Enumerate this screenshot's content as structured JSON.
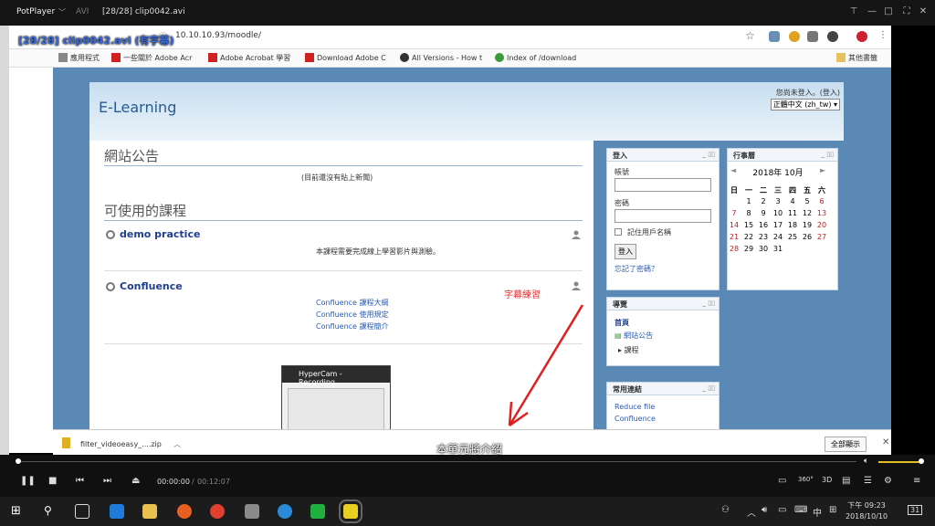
{
  "player": {
    "app": "PotPlayer",
    "format": "AVI",
    "file": "[28/28] clip0042.avi",
    "osd": "[28/28] clip0042.avi (有字幕)",
    "time_current": "00:00:00",
    "time_total": "00:12:07"
  },
  "browser": {
    "url": "10.10.10.93/moodle/",
    "bookmarks": [
      "應用程式",
      "一些關於 Adobe Acr",
      "Adobe Acrobat 學習",
      "Download Adobe C",
      "All Versions - How t",
      "Index of /download"
    ],
    "other_bookmarks": "其他書籤"
  },
  "site": {
    "brand": "E-Learning",
    "login_status": "您尚未登入。(登入)",
    "lang": "正體中文 (zh_tw) ▾",
    "news_title": "網站公告",
    "news_empty": "(目前還沒有貼上新聞)",
    "courses_title": "可使用的課程",
    "courses": [
      {
        "name": "demo practice",
        "desc": "本課程需要完成線上學習影片與測驗。"
      },
      {
        "name": "Confluence",
        "links": [
          "Confluence 課程大綱",
          "Confluence 使用規定",
          "Confluence 課程簡介"
        ]
      }
    ],
    "annotation": "字幕練習"
  },
  "login_block": {
    "title": "登入",
    "user_label": "帳號",
    "pass_label": "密碼",
    "remember": "記住用戶名稱",
    "button": "登入",
    "forgot": "忘記了密碼？"
  },
  "nav_block": {
    "title": "導覽",
    "home": "首頁",
    "items": [
      "網站公告",
      "課程"
    ]
  },
  "links_block": {
    "title": "常用連結",
    "items": [
      "Reduce file",
      "Confluence"
    ]
  },
  "calendar": {
    "title": "行事曆",
    "month": "2018年 10月",
    "prev": "◄",
    "next": "►",
    "weekdays": [
      "日",
      "一",
      "二",
      "三",
      "四",
      "五",
      "六"
    ],
    "weeks": [
      [
        "",
        "1",
        "2",
        "3",
        "4",
        "5",
        "6"
      ],
      [
        "7",
        "8",
        "9",
        "10",
        "11",
        "12",
        "13"
      ],
      [
        "14",
        "15",
        "16",
        "17",
        "18",
        "19",
        "20"
      ],
      [
        "21",
        "22",
        "23",
        "24",
        "25",
        "26",
        "27"
      ],
      [
        "28",
        "29",
        "30",
        "31",
        "",
        "",
        ""
      ]
    ]
  },
  "recorder": {
    "title": "HyperCam - Recording"
  },
  "subtitle": "本單元將介紹",
  "download": {
    "file": "filter_videoeasy_....zip",
    "show_all": "全部顯示"
  },
  "clock": {
    "time": "下午 09:23",
    "date": "2018/10/10"
  },
  "tray": {
    "ime": "中",
    "notif": "31"
  }
}
